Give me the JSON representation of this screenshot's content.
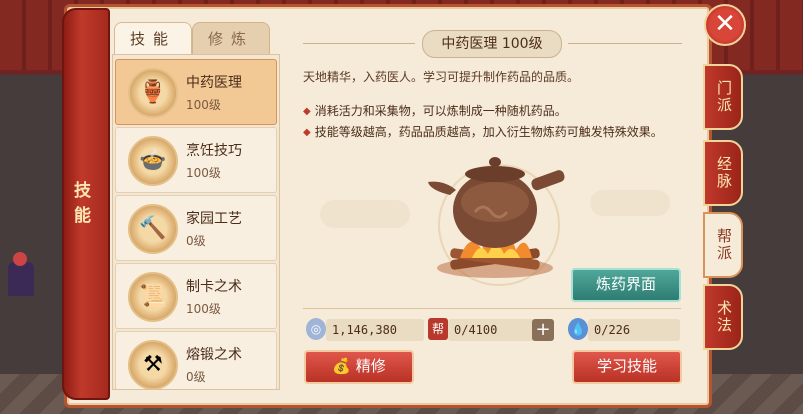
{
  "window": {
    "close_label": "✕"
  },
  "spine": {
    "label": "技能"
  },
  "tabs": [
    {
      "label": "技能"
    },
    {
      "label": "修炼"
    }
  ],
  "skills": [
    {
      "name": "中药医理",
      "level": "100级",
      "icon": "medicine-pot-icon",
      "glyph": "🏺"
    },
    {
      "name": "烹饪技巧",
      "level": "100级",
      "icon": "cooking-dish-icon",
      "glyph": "🍲"
    },
    {
      "name": "家园工艺",
      "level": "0级",
      "icon": "crafting-tools-icon",
      "glyph": "🔨"
    },
    {
      "name": "制卡之术",
      "level": "100级",
      "icon": "card-scroll-icon",
      "glyph": "📜"
    },
    {
      "name": "熔锻之术",
      "level": "0级",
      "icon": "forging-hammer-icon",
      "glyph": "⚒"
    }
  ],
  "side_tabs": [
    {
      "label": "门派"
    },
    {
      "label": "经脉"
    },
    {
      "label": "帮派"
    },
    {
      "label": "术法"
    }
  ],
  "detail": {
    "title": "中药医理 100级",
    "intro": "天地精华，入药医人。学习可提升制作药品的品质。",
    "bullets": [
      "消耗活力和采集物，可以炼制成一种随机药品。",
      "技能等级越高，药品品质越高，加入衍生物炼药可触发特殊效果。"
    ],
    "craft_button": "炼药界面"
  },
  "stats": {
    "silver": "1,146,380",
    "contribution": "0/4100",
    "energy": "0/226",
    "contribution_badge": "帮"
  },
  "buttons": {
    "refine": "精修",
    "learn": "学习技能"
  },
  "colors": {
    "accent_red": "#c0392b",
    "panel_bg": "#f6ead8",
    "craft_teal": "#2e7d72"
  }
}
